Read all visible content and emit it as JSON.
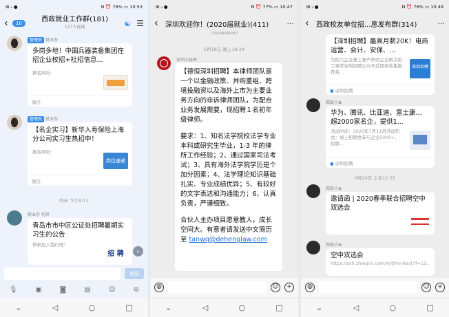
{
  "colors": {
    "link": "#1d6bd6",
    "green": "#2bb24c",
    "blue_ui": "#3a8ee6"
  },
  "p1": {
    "status": {
      "left": "⊞ ᵢₗ ●",
      "right": "N ⏰ 76% ▭ 10:53"
    },
    "header": {
      "badge": "10",
      "title": "西政就业工作群(181)",
      "subtitle": "117人在线"
    },
    "msgs": [
      {
        "tag": "管理员",
        "sender": "就业办",
        "title": "多岗多地！中国兵器装备集团在招企业校招+社招信息...",
        "link_label": "报名网址:",
        "footer": "微信"
      },
      {
        "tag": "管理员",
        "sender": "就业办",
        "title": "【名企实习】新华人寿保险上海分公司实习生热招中！",
        "link_label": "报名网址:",
        "footer": "微信",
        "thumb": "岗位速递"
      },
      {
        "sender": "就业办 何祥",
        "title": "青岛市市中区公证处招聘暑期实习生的公告",
        "link_label": "快来加入我们吧！",
        "thumb": "招 聘"
      }
    ],
    "time": "昨天 下午8:12",
    "send": "发送"
  },
  "p2": {
    "status": {
      "left": "⊞ ᵢₗ ●",
      "right": "N ⏰ 77% ▭ 10:47"
    },
    "header": {
      "title": "深圳欢迎你！(2020届就业)(411)"
    },
    "top_small": "136099998487",
    "time": "6月18日 晚上19:24",
    "sender": "深圳小秘书",
    "message": [
      "【德恒深圳招聘】本律师团队是一个以金融政策、并购重组、跨境投融资以及海外上市为主要业务方向的非诉律师团队，为配合业务发展需要，现招聘１名初年级律师。",
      "要求：1、知名法学院校法学专业本科或研究生毕业，1-3 年的律所工作经验；2、通过国家司法考试；3、具有海外法学院学历是个加分因素；4、法学理论知识基础扎实、专业成绩优异；5、有较好的文字表达和沟通能力；6、认真负责，严谨细致。",
      "合伙人主办项目愿意教人，成长空间大。有意者请发送中文简历至 "
    ],
    "email": "tanwq@dehenglaw.com"
  },
  "p3": {
    "status": {
      "left": "⊞ ᵢₗ ●",
      "right": "N ⏰ 76% ▭ 10:49"
    },
    "header": {
      "title": "西政校友单位招...息发布群(314)"
    },
    "msgs": [
      {
        "title": "【深圳招聘】最高月薪20K！电商运营、会计、安保、...",
        "desc": "为助力企业复工复产帮助企业解决用工难求深圳招聘公众号近期将收集推荐各...",
        "footer": "深圳招聘",
        "thumb": "深圳招聘"
      },
      {
        "sender": "西政小✿",
        "title": "华为、腾讯、比亚迪、富士康... 超2000家名企，提供1...",
        "desc": "活动时间：2020年7月11月活动形式：线上招聘会参与企业2000+, 招聘...",
        "footer": "深圳招聘"
      },
      {
        "sender": "西政小✿",
        "title": "邀请函 | 2020春季联合招聘空中双选会"
      },
      {
        "sender": "西政小✿",
        "title": "空中双选会",
        "desc": "https://sxh.zhaopin.com/m/jf/invite/1?f=12..."
      }
    ],
    "time": "6月20日 上午11:35"
  },
  "nav": {
    "back": "◁",
    "home": "○",
    "recent": "□",
    "down": "⌄"
  }
}
